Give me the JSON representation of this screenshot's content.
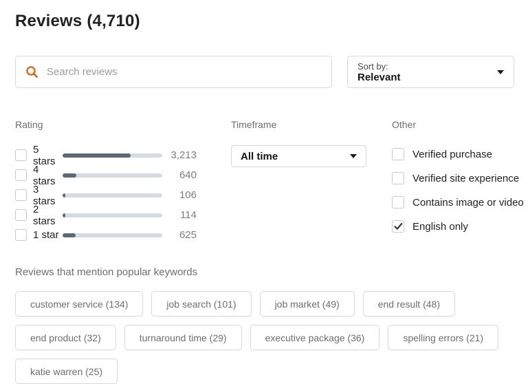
{
  "header": {
    "title": "Reviews (4,710)"
  },
  "search": {
    "placeholder": "Search reviews"
  },
  "sort": {
    "label": "Sort by:",
    "value": "Relevant"
  },
  "filters": {
    "rating": {
      "label": "Rating",
      "options": [
        {
          "label": "5 stars",
          "count": "3,213",
          "pct": 68.2,
          "checked": false
        },
        {
          "label": "4 stars",
          "count": "640",
          "pct": 13.6,
          "checked": false
        },
        {
          "label": "3 stars",
          "count": "106",
          "pct": 2.3,
          "checked": false
        },
        {
          "label": "2 stars",
          "count": "114",
          "pct": 2.4,
          "checked": false
        },
        {
          "label": "1 star",
          "count": "625",
          "pct": 13.3,
          "checked": false
        }
      ]
    },
    "timeframe": {
      "label": "Timeframe",
      "value": "All time"
    },
    "other": {
      "label": "Other",
      "options": [
        {
          "label": "Verified purchase",
          "checked": false
        },
        {
          "label": "Verified site experience",
          "checked": false
        },
        {
          "label": "Contains image or video",
          "checked": false
        },
        {
          "label": "English only",
          "checked": true
        }
      ]
    }
  },
  "keywords": {
    "heading": "Reviews that mention popular keywords",
    "chips": [
      "customer service (134)",
      "job search (101)",
      "job market (49)",
      "end result (48)",
      "end product (32)",
      "turnaround time (29)",
      "executive package (36)",
      "spelling errors (21)",
      "katie warren (25)"
    ]
  },
  "icons": {
    "search": "magnifier",
    "sort_caret": "chevron-down",
    "timeframe_caret": "chevron-down",
    "checked_mark": "checkmark"
  },
  "colors": {
    "accent_orange": "#e4600e",
    "bar_fill": "#5b6a74",
    "bar_track": "#d5dbe0"
  }
}
